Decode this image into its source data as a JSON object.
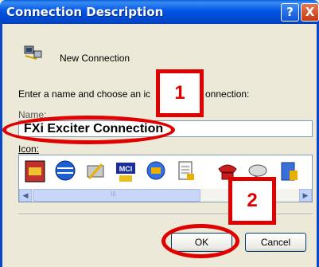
{
  "window": {
    "title": "Connection Description"
  },
  "title_buttons": {
    "help": "?",
    "close": "X"
  },
  "connection": {
    "heading": "New Connection"
  },
  "prompt": {
    "text_left": "Enter a name and choose an ic",
    "text_right": "onnection:"
  },
  "name_field": {
    "label": "Name:",
    "value": "FXi Exciter Connection"
  },
  "icon_field": {
    "label": "Icon:",
    "icons": [
      "phone-icon",
      "globe-icon",
      "satellite-icon",
      "mci-icon",
      "phone-globe-icon",
      "document-icon",
      "red-phone-icon",
      "satellite-dish-icon",
      "book-icon"
    ],
    "scroll_label": "III"
  },
  "buttons": {
    "ok": "OK",
    "cancel": "Cancel"
  },
  "callouts": {
    "first": "1",
    "second": "2"
  },
  "colors": {
    "accent_red": "#E00000",
    "titlebar_blue": "#0055E5"
  }
}
